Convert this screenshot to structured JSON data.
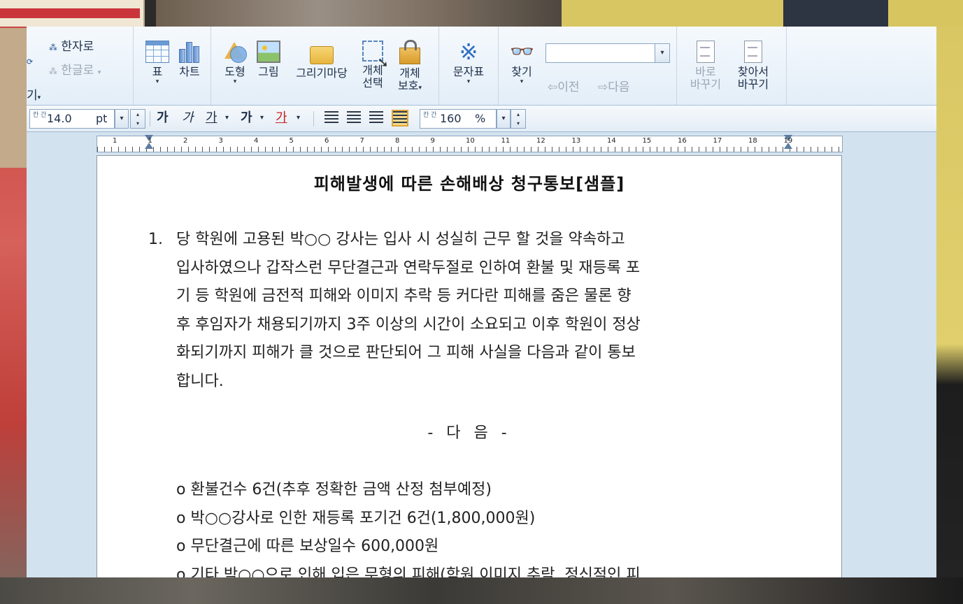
{
  "ribbon": {
    "hanja_label": "한자로",
    "hangul_label": "한글로",
    "left_cut_label": "기",
    "table_label": "표",
    "chart_label": "차트",
    "shape_label": "도형",
    "picture_label": "그림",
    "drawing_label": "그리기마당",
    "object_select_label1": "개체",
    "object_select_label2": "선택",
    "object_protect_label1": "개체",
    "object_protect_label2": "보호",
    "symbol_label": "문자표",
    "find_label": "찾기",
    "find_input_value": "",
    "prev_label": "이전",
    "next_label": "다음",
    "replace_now_label1": "바로",
    "replace_now_label2": "바꾸기",
    "find_replace_label1": "찾아서",
    "find_replace_label2": "바꾸기"
  },
  "format_bar": {
    "size_prefix": "칸 간",
    "font_size": "14.0",
    "font_unit": "pt",
    "bold": "가",
    "italic": "가",
    "underline": "가",
    "strike": "가",
    "color": "가",
    "line_prefix": "칸 간",
    "line_spacing": "160",
    "line_unit": "%"
  },
  "ruler": {
    "numbers": [
      "1",
      "1",
      "2",
      "3",
      "4",
      "5",
      "6",
      "7",
      "8",
      "9",
      "10",
      "11",
      "12",
      "13",
      "14",
      "15",
      "16",
      "17",
      "18",
      "19"
    ]
  },
  "document": {
    "title": "피해발생에 따른 손해배상 청구통보[샘플]",
    "item_number": "1.",
    "paragraph_lines": [
      "당 학원에 고용된 박○○ 강사는 입사 시 성실히 근무 할 것을 약속하고",
      "입사하였으나 갑작스런 무단결근과 연락두절로 인하여 환불 및 재등록 포",
      "기 등 학원에 금전적 피해와 이미지 추락 등 커다란 피해를 줌은 물론 향",
      "후 후임자가 채용되기까지 3주 이상의 시간이 소요되고 이후 학원이 정상",
      "화되기까지 피해가 클 것으로 판단되어 그 피해 사실을 다음과 같이 통보",
      "합니다."
    ],
    "center_heading": "- 다 음 -",
    "list_items": [
      "o 환불건수 6건(추후 정확한 금액 산정 첨부예정)",
      "o 박○○강사로 인한 재등록 포기건 6건(1,800,000원)",
      "o 무단결근에 따른 보상일수 600,000원",
      "o 기타 박○○으로 인해 입은 무형의 피해(학원 이미지 추락, 정신적인 피"
    ]
  }
}
